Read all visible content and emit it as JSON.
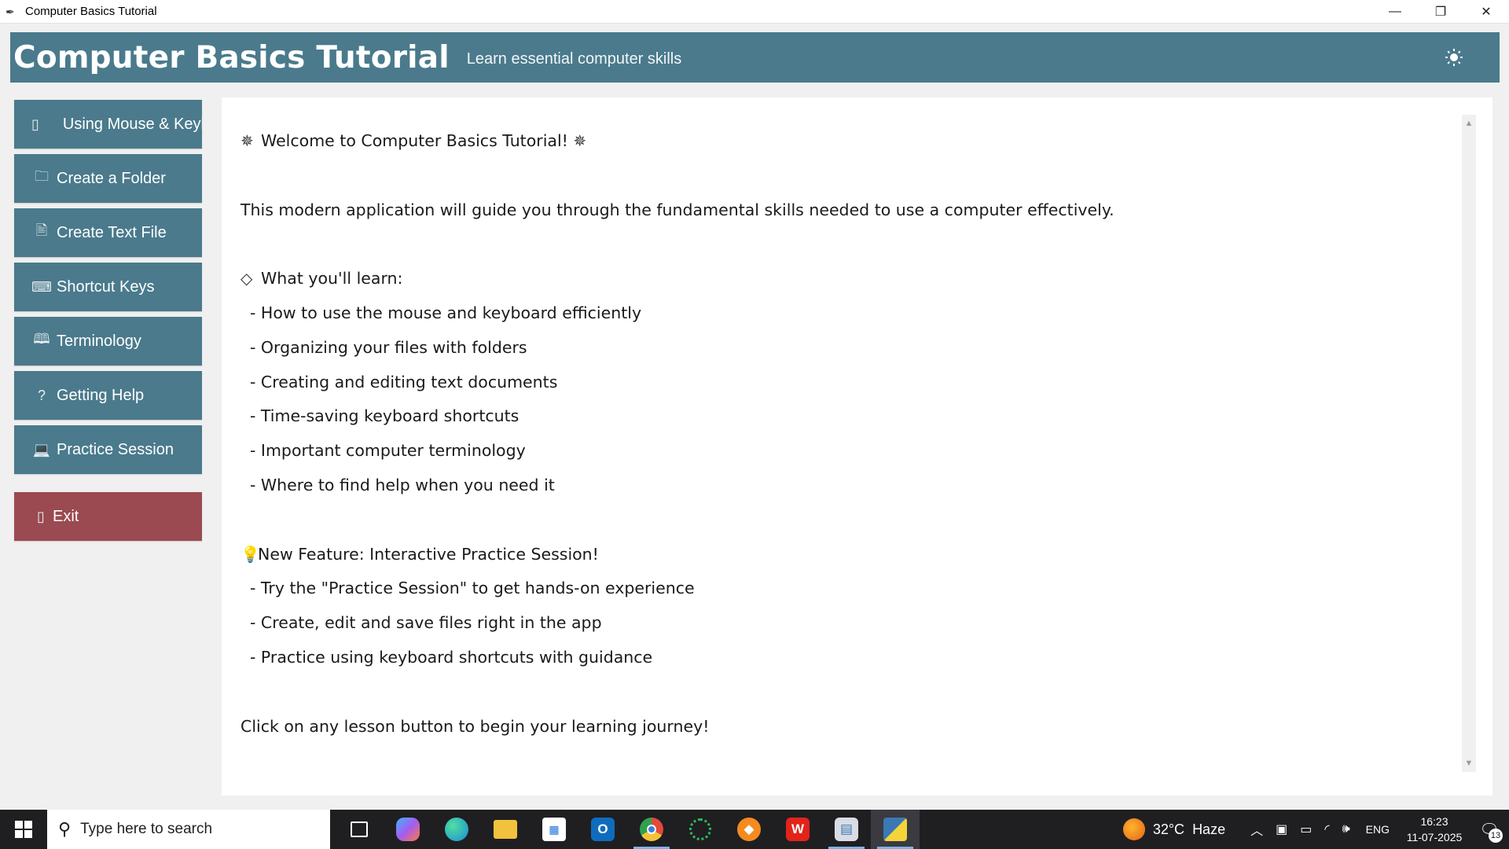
{
  "window": {
    "title": "Computer Basics Tutorial",
    "minimize": "—",
    "restore": "❐",
    "close": "✕"
  },
  "header": {
    "title": "Computer Basics Tutorial",
    "subtitle": "Learn essential computer skills",
    "theme_icon": "sun-icon"
  },
  "sidebar": {
    "items": [
      {
        "label": "Using Mouse & Keyboard",
        "icon": "mouse-icon",
        "glyph": "▯"
      },
      {
        "label": "Create a Folder",
        "icon": "folder-icon",
        "glyph": "🗀"
      },
      {
        "label": "Create Text File",
        "icon": "document-edit-icon",
        "glyph": "🖹"
      },
      {
        "label": "Shortcut Keys",
        "icon": "keyboard-icon",
        "glyph": "⌨"
      },
      {
        "label": "Terminology",
        "icon": "book-icon",
        "glyph": "🕮"
      },
      {
        "label": "Getting Help",
        "icon": "question-icon",
        "glyph": "?"
      },
      {
        "label": "Practice Session",
        "icon": "laptop-icon",
        "glyph": "💻"
      }
    ],
    "exit": {
      "label": "Exit",
      "icon": "door-icon",
      "glyph": "▯"
    }
  },
  "content": {
    "welcome": "Welcome to Computer Basics Tutorial!",
    "intro": "This modern application will guide you through the fundamental skills needed to use a computer effectively.",
    "learn_heading": "What you'll learn:",
    "learn_items": [
      "- How to use the mouse and keyboard efficiently",
      "- Organizing your files with folders",
      "- Creating and editing text documents",
      "- Time-saving keyboard shortcuts",
      "- Important computer terminology",
      "- Where to find help when you need it"
    ],
    "feature_heading": "New Feature: Interactive Practice Session!",
    "feature_items": [
      "- Try the \"Practice Session\" to get hands-on experience",
      "- Create, edit and save files right in the app",
      "- Practice using keyboard shortcuts with guidance"
    ],
    "closing": "Click on any lesson button to begin your learning journey!"
  },
  "taskbar": {
    "search_placeholder": "Type here to search",
    "apps": [
      {
        "name": "task-view-icon",
        "color": "#1f1f22"
      },
      {
        "name": "copilot-icon",
        "color": "#7b5cf0"
      },
      {
        "name": "edge-icon",
        "color": "#1b8ad8"
      },
      {
        "name": "file-explorer-icon",
        "color": "#f2c23c"
      },
      {
        "name": "microsoft-store-icon",
        "color": "#f0f0f0"
      },
      {
        "name": "outlook-icon",
        "color": "#0f6cbd"
      },
      {
        "name": "chrome-icon",
        "color": "#e24a3b"
      },
      {
        "name": "loading-app-icon",
        "color": "#2aa24a"
      },
      {
        "name": "brave-icon",
        "color": "#f58a1f"
      },
      {
        "name": "wps-office-icon",
        "color": "#e2231a"
      },
      {
        "name": "python-idle-icon",
        "color": "#d9dde3"
      },
      {
        "name": "python-app-icon",
        "color": "#3b78b5"
      }
    ],
    "weather": {
      "temp": "32°C",
      "condition": "Haze"
    },
    "language": "ENG",
    "time": "16:23",
    "date": "11-07-2025",
    "notifications": "13"
  }
}
